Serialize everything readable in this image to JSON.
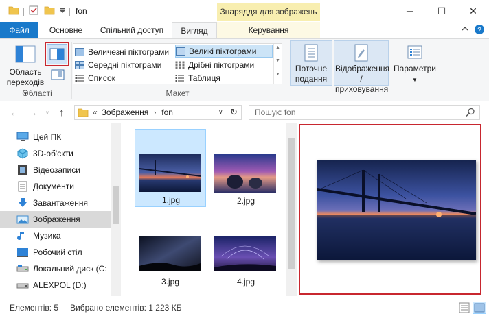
{
  "window": {
    "title": "fon",
    "contextual_tab": "Знаряддя для зображень",
    "controls": {
      "minimize": "─",
      "maximize": "☐",
      "close": "✕"
    }
  },
  "ribbon": {
    "tabs": [
      {
        "label": "Файл"
      },
      {
        "label": "Основне"
      },
      {
        "label": "Спільний доступ"
      },
      {
        "label": "Вигляд"
      },
      {
        "label": "Керування"
      }
    ],
    "panes_group": {
      "nav_pane_label": "Область переходів",
      "group_label": "Області"
    },
    "layout_group": {
      "items": [
        {
          "label": "Величезні піктограми"
        },
        {
          "label": "Великі піктограми",
          "selected": true
        },
        {
          "label": "Середні піктограми"
        },
        {
          "label": "Дрібні піктограми"
        },
        {
          "label": "Список"
        },
        {
          "label": "Таблиця"
        }
      ],
      "group_label": "Макет"
    },
    "current_view_label": "Поточне подання",
    "show_hide_label": "Відображення /приховування",
    "options_label": "Параметри"
  },
  "address": {
    "chevron": "«",
    "crumbs": [
      "Зображення",
      "fon"
    ],
    "search_placeholder": "Пошук: fon"
  },
  "nav_pane": {
    "items": [
      {
        "label": "Цей ПК",
        "icon": "pc-icon"
      },
      {
        "label": "3D-об'єкти",
        "icon": "cube-icon"
      },
      {
        "label": "Відеозаписи",
        "icon": "film-icon"
      },
      {
        "label": "Документи",
        "icon": "document-icon"
      },
      {
        "label": "Завантаження",
        "icon": "download-arrow-icon"
      },
      {
        "label": "Зображення",
        "icon": "pictures-icon",
        "selected": true
      },
      {
        "label": "Музика",
        "icon": "music-note-icon"
      },
      {
        "label": "Робочий стіл",
        "icon": "desktop-icon"
      },
      {
        "label": "Локальний диск (C:",
        "icon": "local-disk-icon"
      },
      {
        "label": "ALEXPOL (D:)",
        "icon": "drive-icon"
      }
    ]
  },
  "files": [
    {
      "name": "1.jpg",
      "selected": true
    },
    {
      "name": "2.jpg"
    },
    {
      "name": "3.jpg"
    },
    {
      "name": "4.jpg"
    }
  ],
  "status": {
    "items_count": "Елементів: 5",
    "selected_info": "Вибрано елементів: 1  223 КБ"
  },
  "colors": {
    "file_tab": "#1979ca",
    "selection": "#cce8ff",
    "highlight_red": "#c8272f",
    "contextual_tab_bg": "#f8eeb0"
  }
}
